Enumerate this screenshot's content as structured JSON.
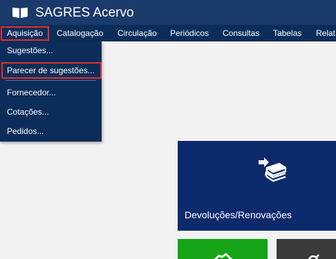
{
  "app": {
    "title": "SAGRES Acervo"
  },
  "menubar": {
    "items": [
      {
        "label": "Aquisição"
      },
      {
        "label": "Catalogação"
      },
      {
        "label": "Circulação"
      },
      {
        "label": "Periódicos"
      },
      {
        "label": "Consultas"
      },
      {
        "label": "Tabelas"
      },
      {
        "label": "Relat"
      }
    ]
  },
  "dropdown": {
    "items": [
      {
        "label": "Sugestões..."
      },
      {
        "label": "Parecer de sugestões..."
      },
      {
        "label": "Fornecedor..."
      },
      {
        "label": "Cotações..."
      },
      {
        "label": "Pedidos..."
      }
    ]
  },
  "tiles": {
    "main": {
      "label": "Devoluções/Renovações",
      "icon": "books-return-icon"
    },
    "green": {
      "icon": "handshake-icon"
    },
    "dark": {
      "icon": "search-icon"
    }
  },
  "colors": {
    "titlebar": "#1a3a6b",
    "menubar": "#0c2d5a",
    "highlight_border": "#e0302e",
    "tile_blue": "#0d2a6d",
    "tile_green": "#15a418",
    "tile_dark": "#3b3b3b"
  }
}
